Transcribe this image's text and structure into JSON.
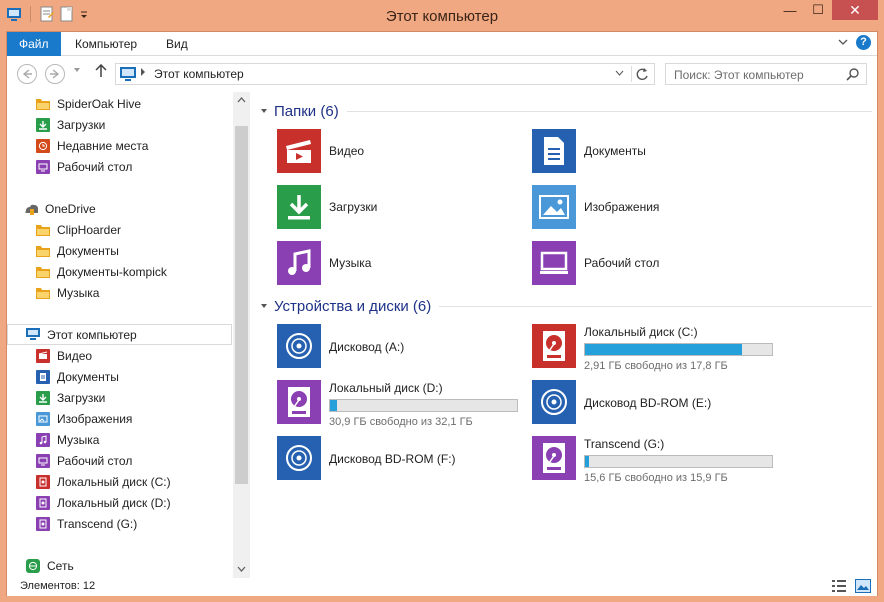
{
  "window": {
    "title": "Этот компьютер",
    "controls": {
      "minimize": "—",
      "maximize": "☐",
      "close": "✕"
    }
  },
  "ribbon": {
    "tabs": [
      {
        "label": "Файл",
        "active": true
      },
      {
        "label": "Компьютер",
        "active": false
      },
      {
        "label": "Вид",
        "active": false
      }
    ],
    "help": "?"
  },
  "address": {
    "path": "Этот компьютер",
    "search_placeholder": "Поиск: Этот компьютер"
  },
  "navpane": {
    "items": [
      {
        "label": "SpiderOak Hive",
        "icon": "folder-icon",
        "color": "#e8a21c"
      },
      {
        "label": "Загрузки",
        "icon": "download-icon",
        "color": "#2a9d4a"
      },
      {
        "label": "Недавние места",
        "icon": "recent-places-icon",
        "color": "#d34a1b"
      },
      {
        "label": "Рабочий стол",
        "icon": "desktop-icon",
        "color": "#8a3fb2"
      },
      {
        "label": "OneDrive",
        "icon": "onedrive-icon",
        "color": "#555555"
      },
      {
        "label": "ClipHoarder",
        "icon": "folder-icon",
        "color": "#e8a21c"
      },
      {
        "label": "Документы",
        "icon": "folder-icon",
        "color": "#e8a21c"
      },
      {
        "label": "Документы-kompick",
        "icon": "folder-icon",
        "color": "#e8a21c"
      },
      {
        "label": "Музыка",
        "icon": "folder-icon",
        "color": "#e8a21c"
      },
      {
        "label": "Этот компьютер",
        "icon": "computer-icon",
        "color": "#1b6fb8",
        "selected": true
      },
      {
        "label": "Видео",
        "icon": "video-icon",
        "color": "#c8302c"
      },
      {
        "label": "Документы",
        "icon": "documents-icon",
        "color": "#2561b0"
      },
      {
        "label": "Загрузки",
        "icon": "download-icon",
        "color": "#2a9d4a"
      },
      {
        "label": "Изображения",
        "icon": "pictures-icon",
        "color": "#4a98d8"
      },
      {
        "label": "Музыка",
        "icon": "music-icon",
        "color": "#8a3fb2"
      },
      {
        "label": "Рабочий стол",
        "icon": "desktop-icon",
        "color": "#8a3fb2"
      },
      {
        "label": "Локальный диск (C:)",
        "icon": "local-disk-icon",
        "color": "#c8302c"
      },
      {
        "label": "Локальный диск (D:)",
        "icon": "local-disk-icon",
        "color": "#8a3fb2"
      },
      {
        "label": "Transcend (G:)",
        "icon": "local-disk-icon",
        "color": "#8a3fb2"
      },
      {
        "label": "Сеть",
        "icon": "network-icon",
        "color": "#2a9d4a"
      }
    ]
  },
  "folders": {
    "title": "Папки (6)",
    "items": [
      {
        "label": "Видео",
        "icon": "video-icon",
        "color": "#c8302c"
      },
      {
        "label": "Документы",
        "icon": "documents-icon",
        "color": "#2561b0"
      },
      {
        "label": "Загрузки",
        "icon": "download-icon",
        "color": "#2a9d4a"
      },
      {
        "label": "Изображения",
        "icon": "pictures-icon",
        "color": "#4a98d8"
      },
      {
        "label": "Музыка",
        "icon": "music-icon",
        "color": "#8a3fb2"
      },
      {
        "label": "Рабочий стол",
        "icon": "desktop-icon",
        "color": "#8a3fb2"
      }
    ]
  },
  "devices": {
    "title": "Устройства и диски (6)",
    "items": [
      {
        "label": "Дисковод (A:)",
        "icon": "disc-drive-icon",
        "color": "#2561b0"
      },
      {
        "label": "Локальный диск (C:)",
        "icon": "local-disk-icon",
        "color": "#c8302c",
        "free": "2,91 ГБ свободно из 17,8 ГБ",
        "used_fraction": 0.84
      },
      {
        "label": "Локальный диск (D:)",
        "icon": "local-disk-icon",
        "color": "#8a3fb2",
        "free": "30,9 ГБ свободно из 32,1 ГБ",
        "used_fraction": 0.04
      },
      {
        "label": "Дисковод BD-ROM (E:)",
        "icon": "disc-drive-icon",
        "color": "#2561b0"
      },
      {
        "label": "Дисковод BD-ROM (F:)",
        "icon": "disc-drive-icon",
        "color": "#2561b0"
      },
      {
        "label": "Transcend (G:)",
        "icon": "local-disk-icon",
        "color": "#8a3fb2",
        "free": "15,6 ГБ свободно из 15,9 ГБ",
        "used_fraction": 0.02
      }
    ]
  },
  "status": {
    "text": "Элементов: 12"
  }
}
